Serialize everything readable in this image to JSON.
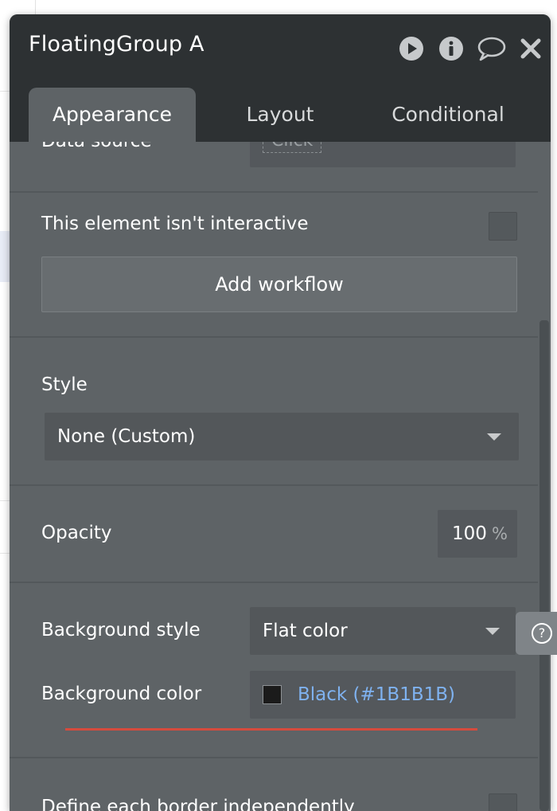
{
  "panel": {
    "title": "FloatingGroup A",
    "header_icons": [
      "play-icon",
      "info-icon",
      "comment-icon",
      "close-icon"
    ]
  },
  "tabs": [
    {
      "label": "Appearance",
      "active": true
    },
    {
      "label": "Layout",
      "active": false
    },
    {
      "label": "Conditional",
      "active": false
    }
  ],
  "data_source": {
    "label": "Data source",
    "value": "Click"
  },
  "interactive": {
    "label": "This element isn't interactive",
    "checked": false
  },
  "workflow": {
    "button_label": "Add workflow"
  },
  "style": {
    "label": "Style",
    "selected": "None (Custom)"
  },
  "opacity": {
    "label": "Opacity",
    "value": "100",
    "unit": "%"
  },
  "background_style": {
    "label": "Background style",
    "selected": "Flat color"
  },
  "background_color": {
    "label": "Background color",
    "value": "Black (#1B1B1B)",
    "swatch": "#1B1B1B",
    "value_color": "#7fb2f0"
  },
  "border": {
    "label": "Define each border independently",
    "checked": false
  },
  "colors": {
    "panel_bg": "#5e6366",
    "header_bg": "#2d3133",
    "accent_underline": "#d54b3d"
  }
}
